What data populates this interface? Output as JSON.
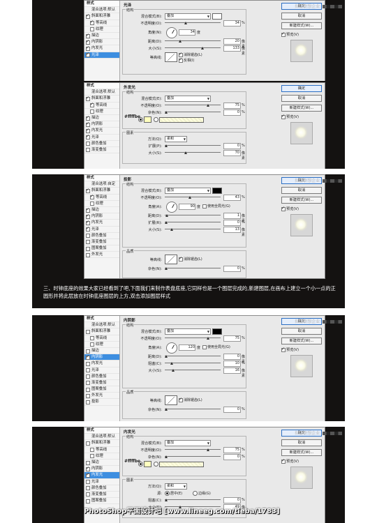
{
  "panel1": {
    "watermark": "拟仿联想企业 ",
    "sidebar": [
      {
        "label": "样式",
        "type": "header"
      },
      {
        "label": "混合选项:默认",
        "type": "plain"
      },
      {
        "label": "斜面和浮雕",
        "checked": true
      },
      {
        "label": "等高线",
        "checked": true,
        "sub": true
      },
      {
        "label": "纹理",
        "checked": false,
        "sub": true
      },
      {
        "label": "描边",
        "checked": true
      },
      {
        "label": "内阴影",
        "checked": true
      },
      {
        "label": "内发光",
        "checked": true
      },
      {
        "label": "光泽",
        "checked": true,
        "selected": true
      }
    ],
    "title": "光泽",
    "group": "结构",
    "blend_label": "混合模式(B):",
    "blend_value": "叠加",
    "opacity_label": "不透明度(O):",
    "opacity_value": "34",
    "angle_label": "角度(N):",
    "angle_value": "34",
    "angle_unit": "度",
    "distance_label": "距离(D):",
    "distance_value": "20",
    "size_label": "大小(S):",
    "size_value": "133",
    "px": "像素",
    "pct": "%",
    "contour_label": "等高线:",
    "antialias": "消除锯齿(L)",
    "invert": "反相(I)",
    "buttons": [
      "确定",
      "取消",
      "新建样式(W)...",
      "预览(V)"
    ]
  },
  "panel2": {
    "sidebar": [
      {
        "label": "样式",
        "type": "header"
      },
      {
        "label": "混合选项:默认",
        "type": "plain"
      },
      {
        "label": "斜面和浮雕",
        "checked": true
      },
      {
        "label": "等高线",
        "checked": true,
        "sub": true
      },
      {
        "label": "纹理",
        "checked": false,
        "sub": true
      },
      {
        "label": "描边",
        "checked": true
      },
      {
        "label": "内阴影",
        "checked": true
      },
      {
        "label": "内发光",
        "checked": true
      },
      {
        "label": "光泽",
        "checked": true
      },
      {
        "label": "颜色叠加",
        "checked": false
      },
      {
        "label": "渐变叠加",
        "checked": false
      }
    ],
    "title": "外发光",
    "group": "结构",
    "blend_label": "混合模式(E):",
    "blend_value": "叠加",
    "opacity_label": "不透明度(O):",
    "opacity_value": "75",
    "noise_label": "杂色(N):",
    "noise_value": "0",
    "hex": "#ffffbe",
    "group2": "图素",
    "method_label": "方法(Q):",
    "method_value": "柔和",
    "spread_label": "扩展(P):",
    "spread_value": "0",
    "size_label": "大小(S):",
    "size_value": "70",
    "px": "像素",
    "pct": "%",
    "buttons": [
      "确定",
      "取消",
      "新建样式(W)...",
      "预览(V)"
    ]
  },
  "panel3": {
    "watermark": "拟仿联想企业 ",
    "sidebar": [
      {
        "label": "样式",
        "type": "header"
      },
      {
        "label": "混合选项:自定",
        "type": "plain"
      },
      {
        "label": "斜面和浮雕",
        "checked": true
      },
      {
        "label": "等高线",
        "checked": true,
        "sub": true
      },
      {
        "label": "纹理",
        "checked": false,
        "sub": true
      },
      {
        "label": "描边",
        "checked": true
      },
      {
        "label": "内阴影",
        "checked": true
      },
      {
        "label": "内发光",
        "checked": true
      },
      {
        "label": "光泽",
        "checked": true
      },
      {
        "label": "颜色叠加",
        "checked": false
      },
      {
        "label": "渐变叠加",
        "checked": false
      },
      {
        "label": "图案叠加",
        "checked": false
      },
      {
        "label": "外发光",
        "checked": false
      }
    ],
    "title": "投影",
    "group": "结构",
    "blend_label": "混合模式(B):",
    "blend_value": "叠加",
    "opacity_label": "不透明度(O):",
    "opacity_value": "43",
    "angle_label": "角度(A):",
    "angle_value": "90",
    "angle_unit": "度",
    "global_light": "使用全局光(G)",
    "distance_label": "距离(D):",
    "distance_value": "1",
    "spread_label": "扩展(R):",
    "spread_value": "0",
    "size_label": "大小(S):",
    "size_value": "13",
    "group2": "品质",
    "contour_label": "等高线:",
    "antialias": "消除锯齿(L)",
    "noise_label": "杂色(N):",
    "noise_value": "0",
    "px": "像素",
    "pct": "%",
    "buttons": [
      "确定",
      "取消",
      "新建样式(W)...",
      "预览(V)"
    ]
  },
  "caption": "三、时钟底座的效果大家已经看到了吧,下面我们来制作表盘底座,它同样也是一个图层完成的,新建图层,在画布上建立一个小一点的正圆形并将此层放在时钟底座图层的上方,双击添加图层样式",
  "panel4": {
    "watermark": "拟仿联想企业 ",
    "sidebar": [
      {
        "label": "样式",
        "type": "header"
      },
      {
        "label": "混合选项:默认",
        "type": "plain"
      },
      {
        "label": "斜面和浮雕",
        "checked": false
      },
      {
        "label": "等高线",
        "checked": false,
        "sub": true
      },
      {
        "label": "纹理",
        "checked": false,
        "sub": true
      },
      {
        "label": "描边",
        "checked": false
      },
      {
        "label": "内阴影",
        "checked": true,
        "selected": true
      },
      {
        "label": "内发光",
        "checked": false
      },
      {
        "label": "光泽",
        "checked": false
      },
      {
        "label": "颜色叠加",
        "checked": false
      },
      {
        "label": "渐变叠加",
        "checked": false
      },
      {
        "label": "图案叠加",
        "checked": false
      },
      {
        "label": "外发光",
        "checked": false
      },
      {
        "label": "投影",
        "checked": false
      }
    ],
    "title": "内阴影",
    "group": "结构",
    "blend_label": "混合模式(B):",
    "blend_value": "叠加",
    "opacity_label": "不透明度(O):",
    "opacity_value": "75",
    "angle_label": "角度(A):",
    "angle_value": "120",
    "angle_unit": "度",
    "global_light": "使用全局光(G)",
    "distance_label": "距离(D):",
    "distance_value": "0",
    "choke_label": "阻塞(C):",
    "choke_value": "10",
    "size_label": "大小(S):",
    "size_value": "16",
    "group2": "品质",
    "contour_label": "等高线:",
    "antialias": "消除锯齿(L)",
    "noise_label": "杂色(N):",
    "noise_value": "0",
    "px": "像素",
    "pct": "%",
    "buttons": [
      "确定",
      "取消",
      "新建样式(W)...",
      "预览(V)"
    ]
  },
  "panel5": {
    "watermark": "拟仿联想企业 ",
    "sidebar": [
      {
        "label": "样式",
        "type": "header"
      },
      {
        "label": "混合选项:默认",
        "type": "plain"
      },
      {
        "label": "斜面和浮雕",
        "checked": false
      },
      {
        "label": "等高线",
        "checked": false,
        "sub": true
      },
      {
        "label": "纹理",
        "checked": false,
        "sub": true
      },
      {
        "label": "描边",
        "checked": false
      },
      {
        "label": "内阴影",
        "checked": true
      },
      {
        "label": "内发光",
        "checked": true,
        "selected": true
      },
      {
        "label": "光泽",
        "checked": false
      },
      {
        "label": "颜色叠加",
        "checked": false
      },
      {
        "label": "渐变叠加",
        "checked": false
      },
      {
        "label": "图案叠加",
        "checked": false
      }
    ],
    "title": "内发光",
    "group": "结构",
    "blend_label": "混合模式(B):",
    "blend_value": "叠加",
    "opacity_label": "不透明度(O):",
    "opacity_value": "75",
    "noise_label": "杂色(N):",
    "noise_value": "0",
    "hex": "#ffffbe",
    "group2": "图素",
    "method_label": "方法(Q):",
    "method_value": "柔和",
    "source_label": "源:",
    "source_center": "居中(E)",
    "source_edge": "边缘(G)",
    "choke_label": "阻塞(C):",
    "choke_value": "0",
    "size_label": "大小(S):",
    "size_value": "49",
    "px": "像素",
    "pct": "%",
    "buttons": [
      "确定",
      "取消",
      "新建样式(W)...",
      "预览(V)"
    ]
  },
  "footer": "PhotoShop平面设计吧 [www.lineeg.com/tieba/1783]"
}
